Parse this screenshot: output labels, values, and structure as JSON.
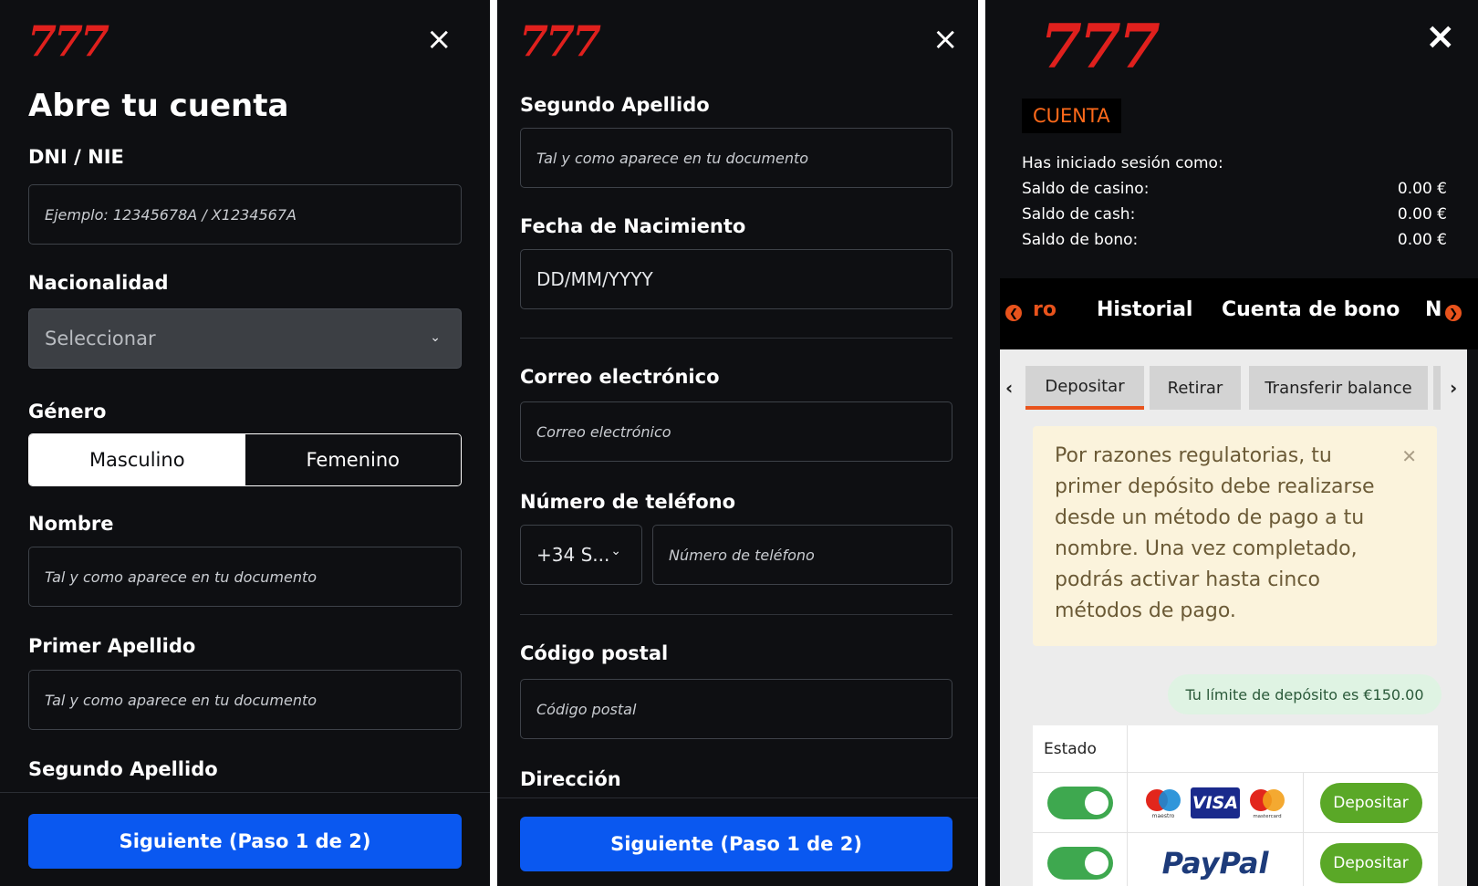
{
  "logo_text": "777",
  "close_glyph": "×",
  "panel1": {
    "title": "Abre tu cuenta",
    "dni_label": "DNI / NIE",
    "dni_placeholder": "Ejemplo: 12345678A / X1234567A",
    "nacionalidad_label": "Nacionalidad",
    "nacionalidad_value": "Seleccionar",
    "genero_label": "Género",
    "genero_options": [
      "Masculino",
      "Femenino"
    ],
    "genero_selected": "Masculino",
    "nombre_label": "Nombre",
    "nombre_placeholder": "Tal y como aparece en tu documento",
    "primer_apellido_label": "Primer Apellido",
    "primer_apellido_placeholder": "Tal y como aparece en tu documento",
    "segundo_apellido_label": "Segundo Apellido",
    "next_button": "Siguiente (Paso 1 de 2)"
  },
  "panel2": {
    "segundo_apellido_label": "Segundo Apellido",
    "segundo_apellido_placeholder": "Tal y como aparece en tu documento",
    "fecha_label": "Fecha de Nacimiento",
    "fecha_placeholder": "DD/MM/YYYY",
    "correo_label": "Correo electrónico",
    "correo_placeholder": "Correo electrónico",
    "telefono_label": "Número de teléfono",
    "telefono_prefix": "+34 S...",
    "telefono_placeholder": "Número de teléfono",
    "postal_label": "Código postal",
    "postal_placeholder": "Código postal",
    "direccion_label": "Dirección",
    "next_button": "Siguiente (Paso 1 de 2)"
  },
  "panel3": {
    "badge": "CUENTA",
    "logged_in_label": "Has iniciado sesión como:",
    "balances": [
      {
        "label": "Saldo de casino:",
        "value": "0.00 €"
      },
      {
        "label": "Saldo de cash:",
        "value": "0.00 €"
      },
      {
        "label": "Saldo de bono:",
        "value": "0.00 €"
      }
    ],
    "nav": {
      "items": [
        "ro",
        "Historial",
        "Cuenta de bono",
        "N"
      ],
      "accent_color": "#e8531c"
    },
    "tabs": [
      "Depositar",
      "Retirar",
      "Transferir balance"
    ],
    "active_tab": "Depositar",
    "notice": "Por razones regulatorias, tu primer depósito debe realizarse desde un método de pago a tu nombre. Una vez completado, podrás activar hasta cinco métodos de pago.",
    "limit": "Tu límite de depósito es €150.00",
    "table_header": "Estado",
    "methods": [
      {
        "logos": [
          "maestro",
          "VISA",
          "mastercard"
        ],
        "enabled": true,
        "button": "Depositar"
      },
      {
        "logos": [
          "PayPal"
        ],
        "enabled": true,
        "button": "Depositar"
      }
    ]
  }
}
